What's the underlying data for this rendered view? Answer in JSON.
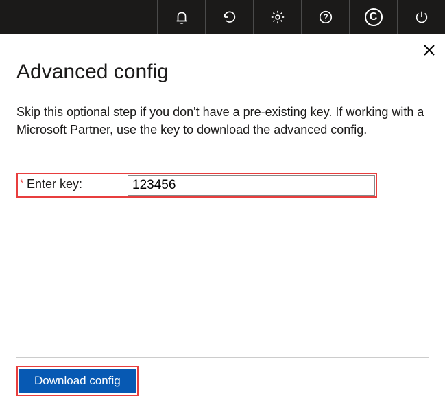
{
  "topbar": {
    "icons": [
      "bell-icon",
      "refresh-icon",
      "gear-icon",
      "help-icon",
      "copyright-icon",
      "power-icon"
    ],
    "copyright_glyph": "C"
  },
  "panel": {
    "title": "Advanced config",
    "description": "Skip this optional step if you don't have a pre-existing key. If working with a Microsoft Partner, use the key to download the advanced config.",
    "field": {
      "required_mark": "*",
      "label": "Enter key:",
      "value": "123456"
    },
    "download_label": "Download config"
  }
}
